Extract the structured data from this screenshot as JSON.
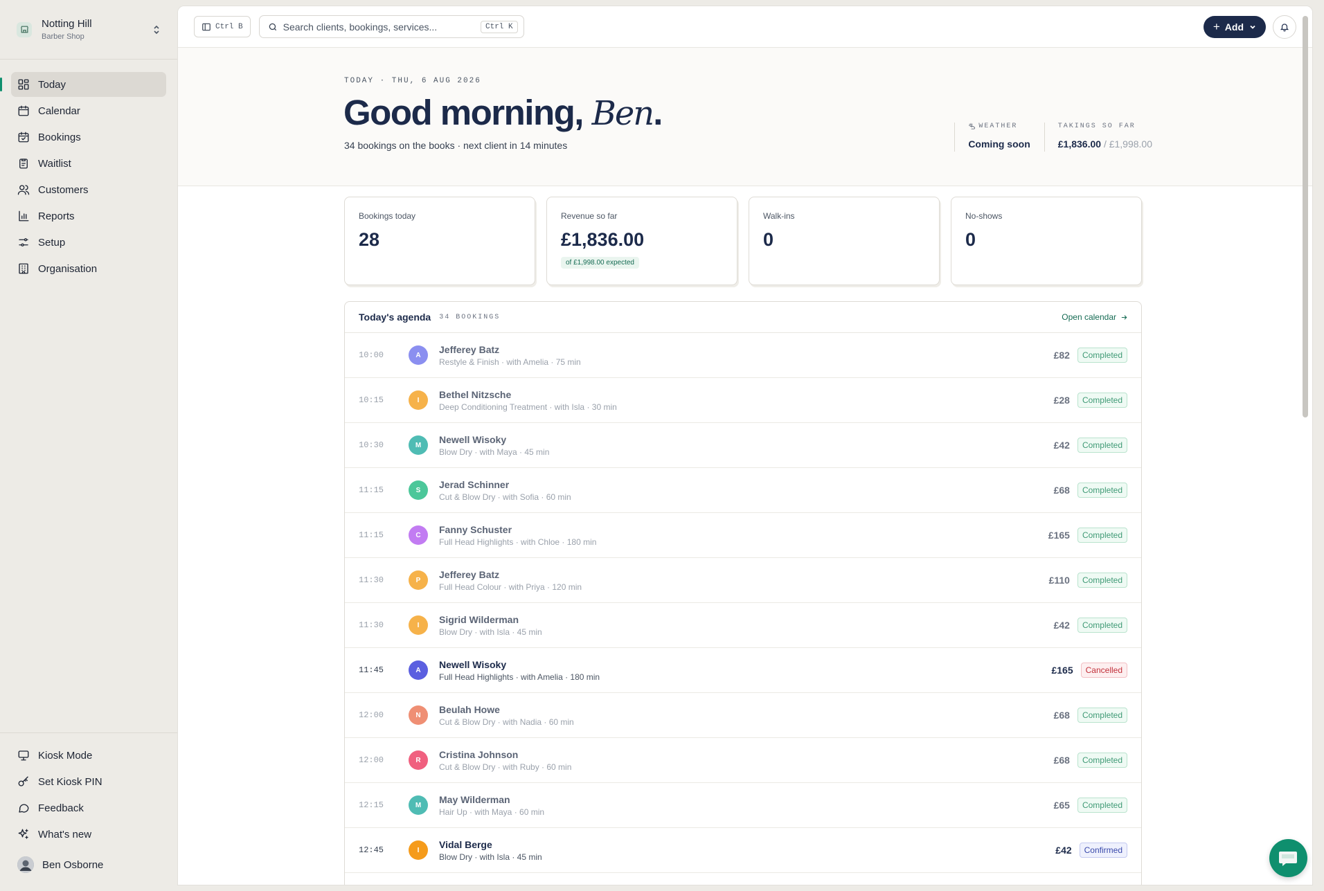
{
  "org": {
    "name": "Notting Hill",
    "type": "Barber Shop"
  },
  "nav": [
    {
      "label": "Today",
      "icon": "dashboard-icon",
      "active": true
    },
    {
      "label": "Calendar",
      "icon": "calendar-icon"
    },
    {
      "label": "Bookings",
      "icon": "calendar-check-icon"
    },
    {
      "label": "Waitlist",
      "icon": "clipboard-icon"
    },
    {
      "label": "Customers",
      "icon": "users-icon"
    },
    {
      "label": "Reports",
      "icon": "bar-chart-icon"
    },
    {
      "label": "Setup",
      "icon": "sliders-icon"
    },
    {
      "label": "Organisation",
      "icon": "building-icon"
    }
  ],
  "bottom_nav": [
    {
      "label": "Kiosk Mode",
      "icon": "monitor-icon"
    },
    {
      "label": "Set Kiosk PIN",
      "icon": "key-icon"
    },
    {
      "label": "Feedback",
      "icon": "message-icon"
    },
    {
      "label": "What's new",
      "icon": "sparkles-icon"
    }
  ],
  "user": {
    "name": "Ben Osborne"
  },
  "topbar": {
    "sidebar_shortcut": "Ctrl B",
    "search_placeholder": "Search clients, bookings, services...",
    "search_shortcut": "Ctrl K",
    "add_label": "Add"
  },
  "hero": {
    "eyebrow": "TODAY · THU, 6 AUG 2026",
    "greeting": "Good morning,",
    "name": "Ben",
    "subline": "34 bookings on the books · next client in 14 minutes",
    "weather_label": "WEATHER",
    "weather_value": "Coming soon",
    "takings_label": "TAKINGS SO FAR",
    "takings_value": "£1,836.00",
    "takings_expected": "/ £1,998.00"
  },
  "cards": [
    {
      "label": "Bookings today",
      "value": "28"
    },
    {
      "label": "Revenue so far",
      "value": "£1,836.00",
      "pill": "of £1,998.00 expected"
    },
    {
      "label": "Walk-ins",
      "value": "0"
    },
    {
      "label": "No-shows",
      "value": "0"
    }
  ],
  "agenda": {
    "title": "Today's agenda",
    "count": "34 BOOKINGS",
    "open_calendar": "Open calendar",
    "rows": [
      {
        "time": "10:00",
        "initial": "A",
        "color": "#8b8ff0",
        "name": "Jefferey Batz",
        "service": "Restyle & Finish · with Amelia · 75 min",
        "price": "£82",
        "status": "Completed"
      },
      {
        "time": "10:15",
        "initial": "I",
        "color": "#f6b24a",
        "name": "Bethel Nitzsche",
        "service": "Deep Conditioning Treatment · with Isla · 30 min",
        "price": "£28",
        "status": "Completed"
      },
      {
        "time": "10:30",
        "initial": "M",
        "color": "#4fbcb4",
        "name": "Newell Wisoky",
        "service": "Blow Dry · with Maya · 45 min",
        "price": "£42",
        "status": "Completed"
      },
      {
        "time": "11:15",
        "initial": "S",
        "color": "#4cc79a",
        "name": "Jerad Schinner",
        "service": "Cut & Blow Dry · with Sofia · 60 min",
        "price": "£68",
        "status": "Completed"
      },
      {
        "time": "11:15",
        "initial": "C",
        "color": "#c27cf2",
        "name": "Fanny Schuster",
        "service": "Full Head Highlights · with Chloe · 180 min",
        "price": "£165",
        "status": "Completed"
      },
      {
        "time": "11:30",
        "initial": "P",
        "color": "#f6b24a",
        "name": "Jefferey Batz",
        "service": "Full Head Colour · with Priya · 120 min",
        "price": "£110",
        "status": "Completed"
      },
      {
        "time": "11:30",
        "initial": "I",
        "color": "#f6b24a",
        "name": "Sigrid Wilderman",
        "service": "Blow Dry · with Isla · 45 min",
        "price": "£42",
        "status": "Completed"
      },
      {
        "time": "11:45",
        "initial": "A",
        "color": "#5b5fe0",
        "name": "Newell Wisoky",
        "service": "Full Head Highlights · with Amelia · 180 min",
        "price": "£165",
        "status": "Cancelled",
        "active": true
      },
      {
        "time": "12:00",
        "initial": "N",
        "color": "#ef8f74",
        "name": "Beulah Howe",
        "service": "Cut & Blow Dry · with Nadia · 60 min",
        "price": "£68",
        "status": "Completed"
      },
      {
        "time": "12:00",
        "initial": "R",
        "color": "#f0607f",
        "name": "Cristina Johnson",
        "service": "Cut & Blow Dry · with Ruby · 60 min",
        "price": "£68",
        "status": "Completed"
      },
      {
        "time": "12:15",
        "initial": "M",
        "color": "#4fbcb4",
        "name": "May Wilderman",
        "service": "Hair Up · with Maya · 60 min",
        "price": "£65",
        "status": "Completed"
      },
      {
        "time": "12:45",
        "initial": "I",
        "color": "#f59b1b",
        "name": "Vidal Berge",
        "service": "Blow Dry · with Isla · 45 min",
        "price": "£42",
        "status": "Confirmed",
        "active": true
      }
    ]
  },
  "colors": {
    "accent": "#0f8f6e",
    "primary": "#1c2a4a",
    "completed": "#3f9a75",
    "cancelled": "#c2303a",
    "confirmed": "#3949ab"
  }
}
